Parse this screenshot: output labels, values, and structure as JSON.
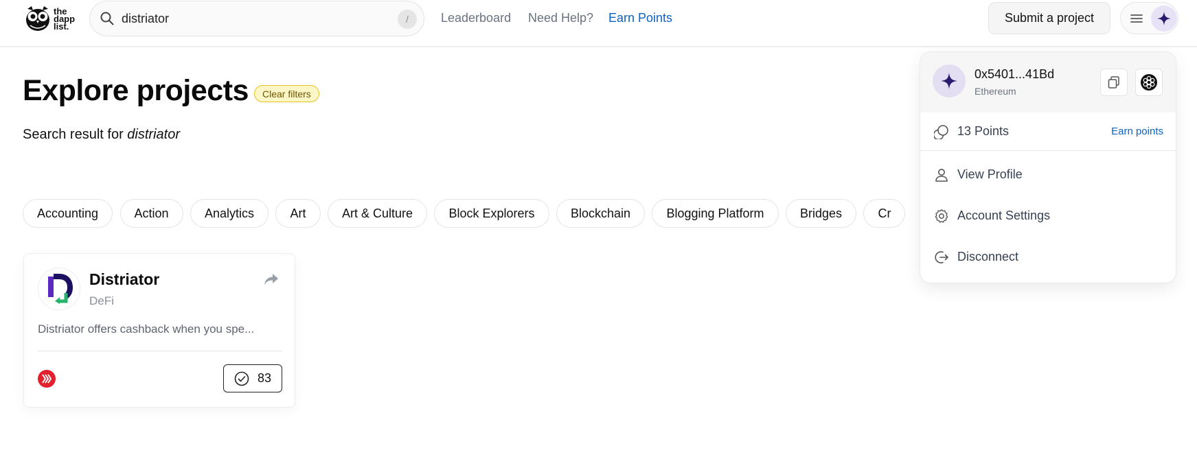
{
  "brand": {
    "logo_lines": [
      "the",
      "dapp",
      "list."
    ]
  },
  "search": {
    "value": "distriator",
    "placeholder": "Search",
    "shortcut": "/"
  },
  "nav": {
    "leaderboard": "Leaderboard",
    "help": "Need Help?",
    "earn": "Earn Points"
  },
  "header": {
    "submit_label": "Submit a project"
  },
  "main": {
    "title": "Explore projects",
    "clear_filters": "Clear filters",
    "search_result_prefix": "Search result for",
    "search_term": "distriator",
    "categories": [
      "Accounting",
      "Action",
      "Analytics",
      "Art",
      "Art & Culture",
      "Block Explorers",
      "Blockchain",
      "Blogging Platform",
      "Bridges",
      "Cr"
    ]
  },
  "card": {
    "name": "Distriator",
    "category": "DeFi",
    "description": "Distriator offers cashback when you spe...",
    "votes": "83"
  },
  "account": {
    "address": "0x5401...41Bd",
    "network": "Ethereum",
    "points": "13 Points",
    "earn_points": "Earn points",
    "view_profile": "View Profile",
    "account_settings": "Account Settings",
    "disconnect": "Disconnect"
  },
  "colors": {
    "accent_blue": "#0b61c4",
    "avatar_star": "#2a1a6e",
    "chain_red": "#e3202e"
  }
}
